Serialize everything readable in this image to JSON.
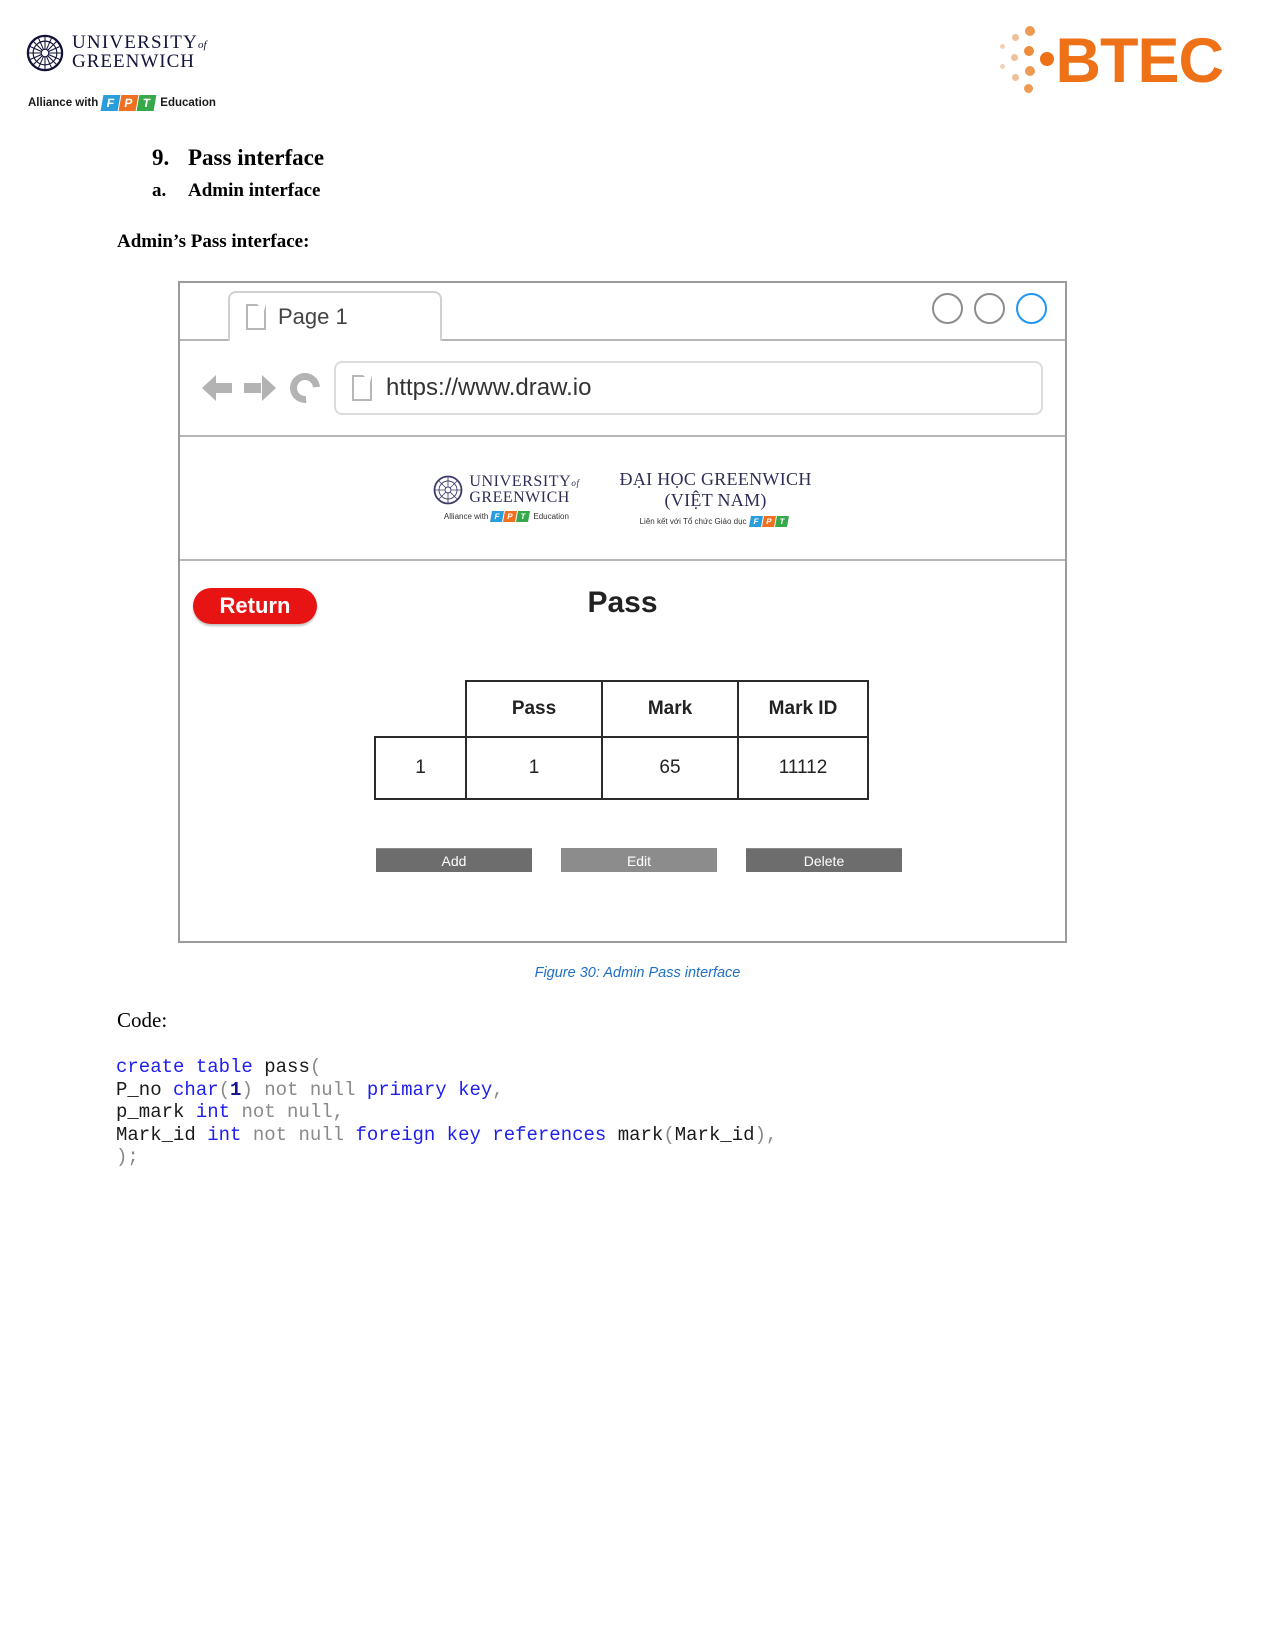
{
  "header": {
    "university": {
      "line1": "UNIVERSITY",
      "of": "of",
      "line2": "GREENWICH"
    },
    "alliance": {
      "prefix": "Alliance with",
      "f": "F",
      "p": "P",
      "t": "T",
      "suffix": "Education"
    },
    "btec": {
      "word": "BTEC",
      "color": "#ee7118"
    }
  },
  "document": {
    "section_number": "9.",
    "section_title": "Pass interface",
    "subsection_marker": "a.",
    "subsection_title": "Admin interface",
    "lead_text": "Admin’s Pass interface:",
    "figure_caption": "Figure 30: Admin Pass interface",
    "code_label": "Code:"
  },
  "browser": {
    "tab": {
      "label": "Page 1",
      "icon": "document-icon"
    },
    "window_controls": [
      {
        "name": "minimize-circle",
        "active": false
      },
      {
        "name": "maximize-circle",
        "active": false
      },
      {
        "name": "close-circle",
        "active": true,
        "color": "#2196f3"
      }
    ],
    "toolbar": {
      "back_icon": "back-arrow-icon",
      "forward_icon": "forward-arrow-icon",
      "reload_icon": "reload-icon",
      "url_icon": "page-icon",
      "url": "https://www.draw.io"
    }
  },
  "app": {
    "brand": {
      "uog_line1": "UNIVERSITY",
      "uog_of": "of",
      "uog_line2": "GREENWICH",
      "uog_alliance_prefix": "Alliance with",
      "uog_alliance_suffix": "Education",
      "vn_line1": "ĐẠI HỌC GREENWICH",
      "vn_line2": "(VIỆT NAM)",
      "vn_sub": "Liên kết với Tổ chức Giáo dục"
    },
    "return_button": "Return",
    "title": "Pass",
    "table": {
      "headers": [
        "",
        "Pass",
        "Mark",
        "Mark ID"
      ],
      "rows": [
        [
          "1",
          "1",
          "65",
          "11112"
        ]
      ]
    },
    "actions": [
      {
        "label": "Add",
        "name": "add-button"
      },
      {
        "label": "Edit",
        "name": "edit-button"
      },
      {
        "label": "Delete",
        "name": "delete-button"
      }
    ],
    "accent_color": "#e81414"
  },
  "code": {
    "lines": [
      [
        {
          "t": "create table ",
          "c": "kw"
        },
        {
          "t": "pass",
          "c": "pl"
        },
        {
          "t": "(",
          "c": "gr"
        }
      ],
      [
        {
          "t": "P_no ",
          "c": "pl"
        },
        {
          "t": "char",
          "c": "kw"
        },
        {
          "t": "(",
          "c": "gr"
        },
        {
          "t": "1",
          "c": "num"
        },
        {
          "t": ") ",
          "c": "gr"
        },
        {
          "t": "not null ",
          "c": "gr"
        },
        {
          "t": "primary key",
          "c": "kw"
        },
        {
          "t": ",",
          "c": "gr"
        }
      ],
      [
        {
          "t": "p_mark ",
          "c": "pl"
        },
        {
          "t": "int",
          "c": "kw"
        },
        {
          "t": " not null,",
          "c": "gr"
        }
      ],
      [
        {
          "t": "Mark_id ",
          "c": "pl"
        },
        {
          "t": "int",
          "c": "kw"
        },
        {
          "t": " not null ",
          "c": "gr"
        },
        {
          "t": "foreign key references",
          "c": "kw"
        },
        {
          "t": " mark",
          "c": "pl"
        },
        {
          "t": "(",
          "c": "gr"
        },
        {
          "t": "Mark_id",
          "c": "pl"
        },
        {
          "t": "),",
          "c": "gr"
        }
      ],
      [
        {
          "t": ");",
          "c": "gr"
        }
      ]
    ]
  }
}
